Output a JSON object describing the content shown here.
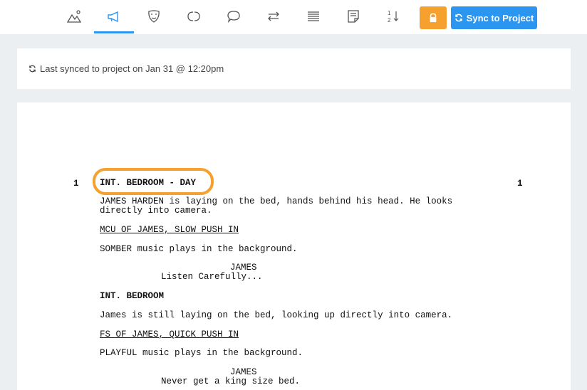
{
  "toolbar": {
    "icons": [
      {
        "name": "landscape-icon"
      },
      {
        "name": "megaphone-icon"
      },
      {
        "name": "mask-icon"
      },
      {
        "name": "loop-icon"
      },
      {
        "name": "speech-bubble-icon"
      },
      {
        "name": "swap-arrows-icon"
      },
      {
        "name": "lines-icon"
      },
      {
        "name": "note-icon"
      },
      {
        "name": "sort-numbers-icon"
      }
    ],
    "active_index": 1,
    "sync_label": "Sync to Project",
    "accent": "#2b95f0",
    "lock_color": "#f6a02d"
  },
  "status": {
    "text": "Last synced to project on Jan 31 @ 12:20pm"
  },
  "script": {
    "scene_number_left": "1",
    "scene_number_right": "1",
    "lines": [
      {
        "text": "INT. BEDROOM - DAY",
        "style": "heading"
      },
      {
        "text": "JAMES HARDEN is laying on the bed, hands behind his head. He looks",
        "style": "action"
      },
      {
        "text": "directly into camera.",
        "style": "action"
      },
      {
        "text": "MCU OF JAMES, SLOW PUSH IN",
        "style": "shot"
      },
      {
        "text": "SOMBER music plays in the background.",
        "style": "action"
      },
      {
        "text": "JAMES",
        "style": "character"
      },
      {
        "text": "Listen Carefully...",
        "style": "dialogue"
      },
      {
        "text": "INT. BEDROOM",
        "style": "heading"
      },
      {
        "text": "James is still laying on the bed, looking up directly into camera.",
        "style": "action"
      },
      {
        "text": "FS OF JAMES, QUICK PUSH IN",
        "style": "shot"
      },
      {
        "text": "PLAYFUL music plays in the background.",
        "style": "action"
      },
      {
        "text": "JAMES",
        "style": "character"
      },
      {
        "text": "Never get a king size bed.",
        "style": "dialogue"
      }
    ]
  }
}
